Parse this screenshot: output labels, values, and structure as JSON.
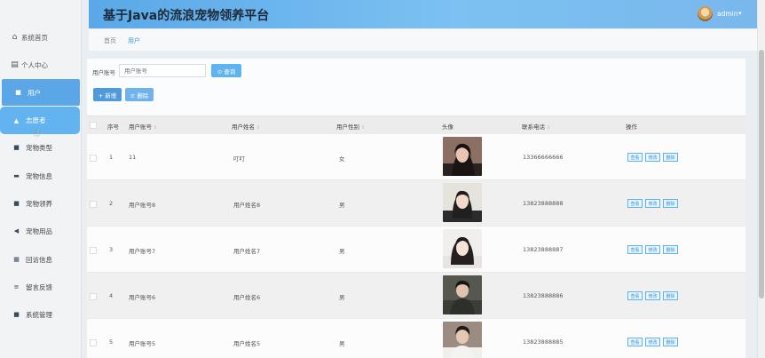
{
  "header": {
    "title": "基于Java的流浪宠物领养平台",
    "user": "admin",
    "user_caret": "▾",
    "accent": "#5ba6e6"
  },
  "sidebar": {
    "items": [
      {
        "label": "系统首页",
        "icon": "home-icon",
        "glyph": "⌂"
      },
      {
        "label": "个人中心",
        "icon": "person-card-icon",
        "glyph": "▤"
      },
      {
        "label": "用户",
        "icon": "grid-icon",
        "glyph": "■"
      },
      {
        "label": "志愿者",
        "icon": "person-icon",
        "glyph": "▲"
      },
      {
        "label": "宠物类型",
        "icon": "grid-icon",
        "glyph": "■"
      },
      {
        "label": "宠物信息",
        "icon": "monitor-icon",
        "glyph": "▬"
      },
      {
        "label": "宠物领养",
        "icon": "grid-icon",
        "glyph": "■"
      },
      {
        "label": "宠物用品",
        "icon": "shopping-icon",
        "glyph": "◀"
      },
      {
        "label": "回访信息",
        "icon": "table-icon",
        "glyph": "▦"
      },
      {
        "label": "留言反馈",
        "icon": "list-icon",
        "glyph": "≡"
      },
      {
        "label": "系统管理",
        "icon": "grid-icon",
        "glyph": "■"
      }
    ]
  },
  "breadcrumb": {
    "home": "首页",
    "current": "用户"
  },
  "search": {
    "label": "用户账号",
    "placeholder": "用户账号",
    "button": "⊙ 查询",
    "add": "+ 新增",
    "delete": "≡ 删除"
  },
  "table": {
    "headers": {
      "index": "序号",
      "account": "用户账号",
      "name": "用户姓名",
      "gender": "用户性别",
      "avatar": "头像",
      "phone": "联系电话",
      "ops": "操作"
    },
    "sort_glyph": "⇕",
    "rows": [
      {
        "index": "1",
        "account": "11",
        "name": "叮叮",
        "gender": "女",
        "phone": "13366666666"
      },
      {
        "index": "2",
        "account": "用户账号8",
        "name": "用户姓名8",
        "gender": "男",
        "phone": "13823888888"
      },
      {
        "index": "3",
        "account": "用户账号7",
        "name": "用户姓名7",
        "gender": "男",
        "phone": "13823888887"
      },
      {
        "index": "4",
        "account": "用户账号6",
        "name": "用户姓名6",
        "gender": "男",
        "phone": "13823888886"
      },
      {
        "index": "5",
        "account": "用户账号5",
        "name": "用户姓名5",
        "gender": "男",
        "phone": "13823888885"
      }
    ],
    "actions": {
      "view": "查看",
      "edit": "修改",
      "delete": "删除"
    }
  }
}
